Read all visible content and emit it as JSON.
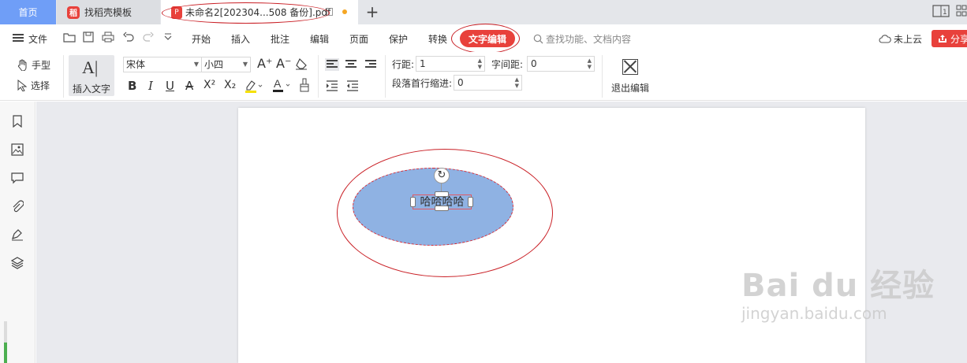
{
  "tabs": {
    "home": "首页",
    "template": "找稻壳模板",
    "document": "未命名2[202304...508 备份].pdf",
    "add": "+"
  },
  "menu": {
    "file": "文件",
    "items": [
      "开始",
      "插入",
      "批注",
      "编辑",
      "页面",
      "保护",
      "转换"
    ],
    "active": "文字编辑",
    "search_placeholder": "查找功能、文档内容",
    "cloud": "未上云",
    "share": "分享"
  },
  "ribbon": {
    "hand": "手型",
    "select": "选择",
    "insert_text": "插入文字",
    "insert_text_glyph": "A|",
    "font_name": "宋体",
    "font_size": "小四",
    "line_spacing_label": "行距:",
    "line_spacing_value": "1",
    "char_spacing_label": "字间距:",
    "char_spacing_value": "0",
    "indent_label": "段落首行缩进:",
    "indent_value": "0",
    "exit_edit": "退出编辑",
    "grow_font": "A⁺",
    "shrink_font": "A⁻",
    "bold": "B",
    "italic": "I",
    "underline": "U",
    "strike": "A",
    "superscript": "X²",
    "subscript": "X₂"
  },
  "document": {
    "shape_text": "哈哈哈哈"
  },
  "watermark": {
    "main": "Bai du 经验",
    "sub": "jingyan.baidu.com"
  },
  "colors": {
    "accent": "#e8413b",
    "home_tab": "#6f9ef7",
    "shape_fill": "#8fb2e3",
    "annotation": "#c91f25"
  }
}
